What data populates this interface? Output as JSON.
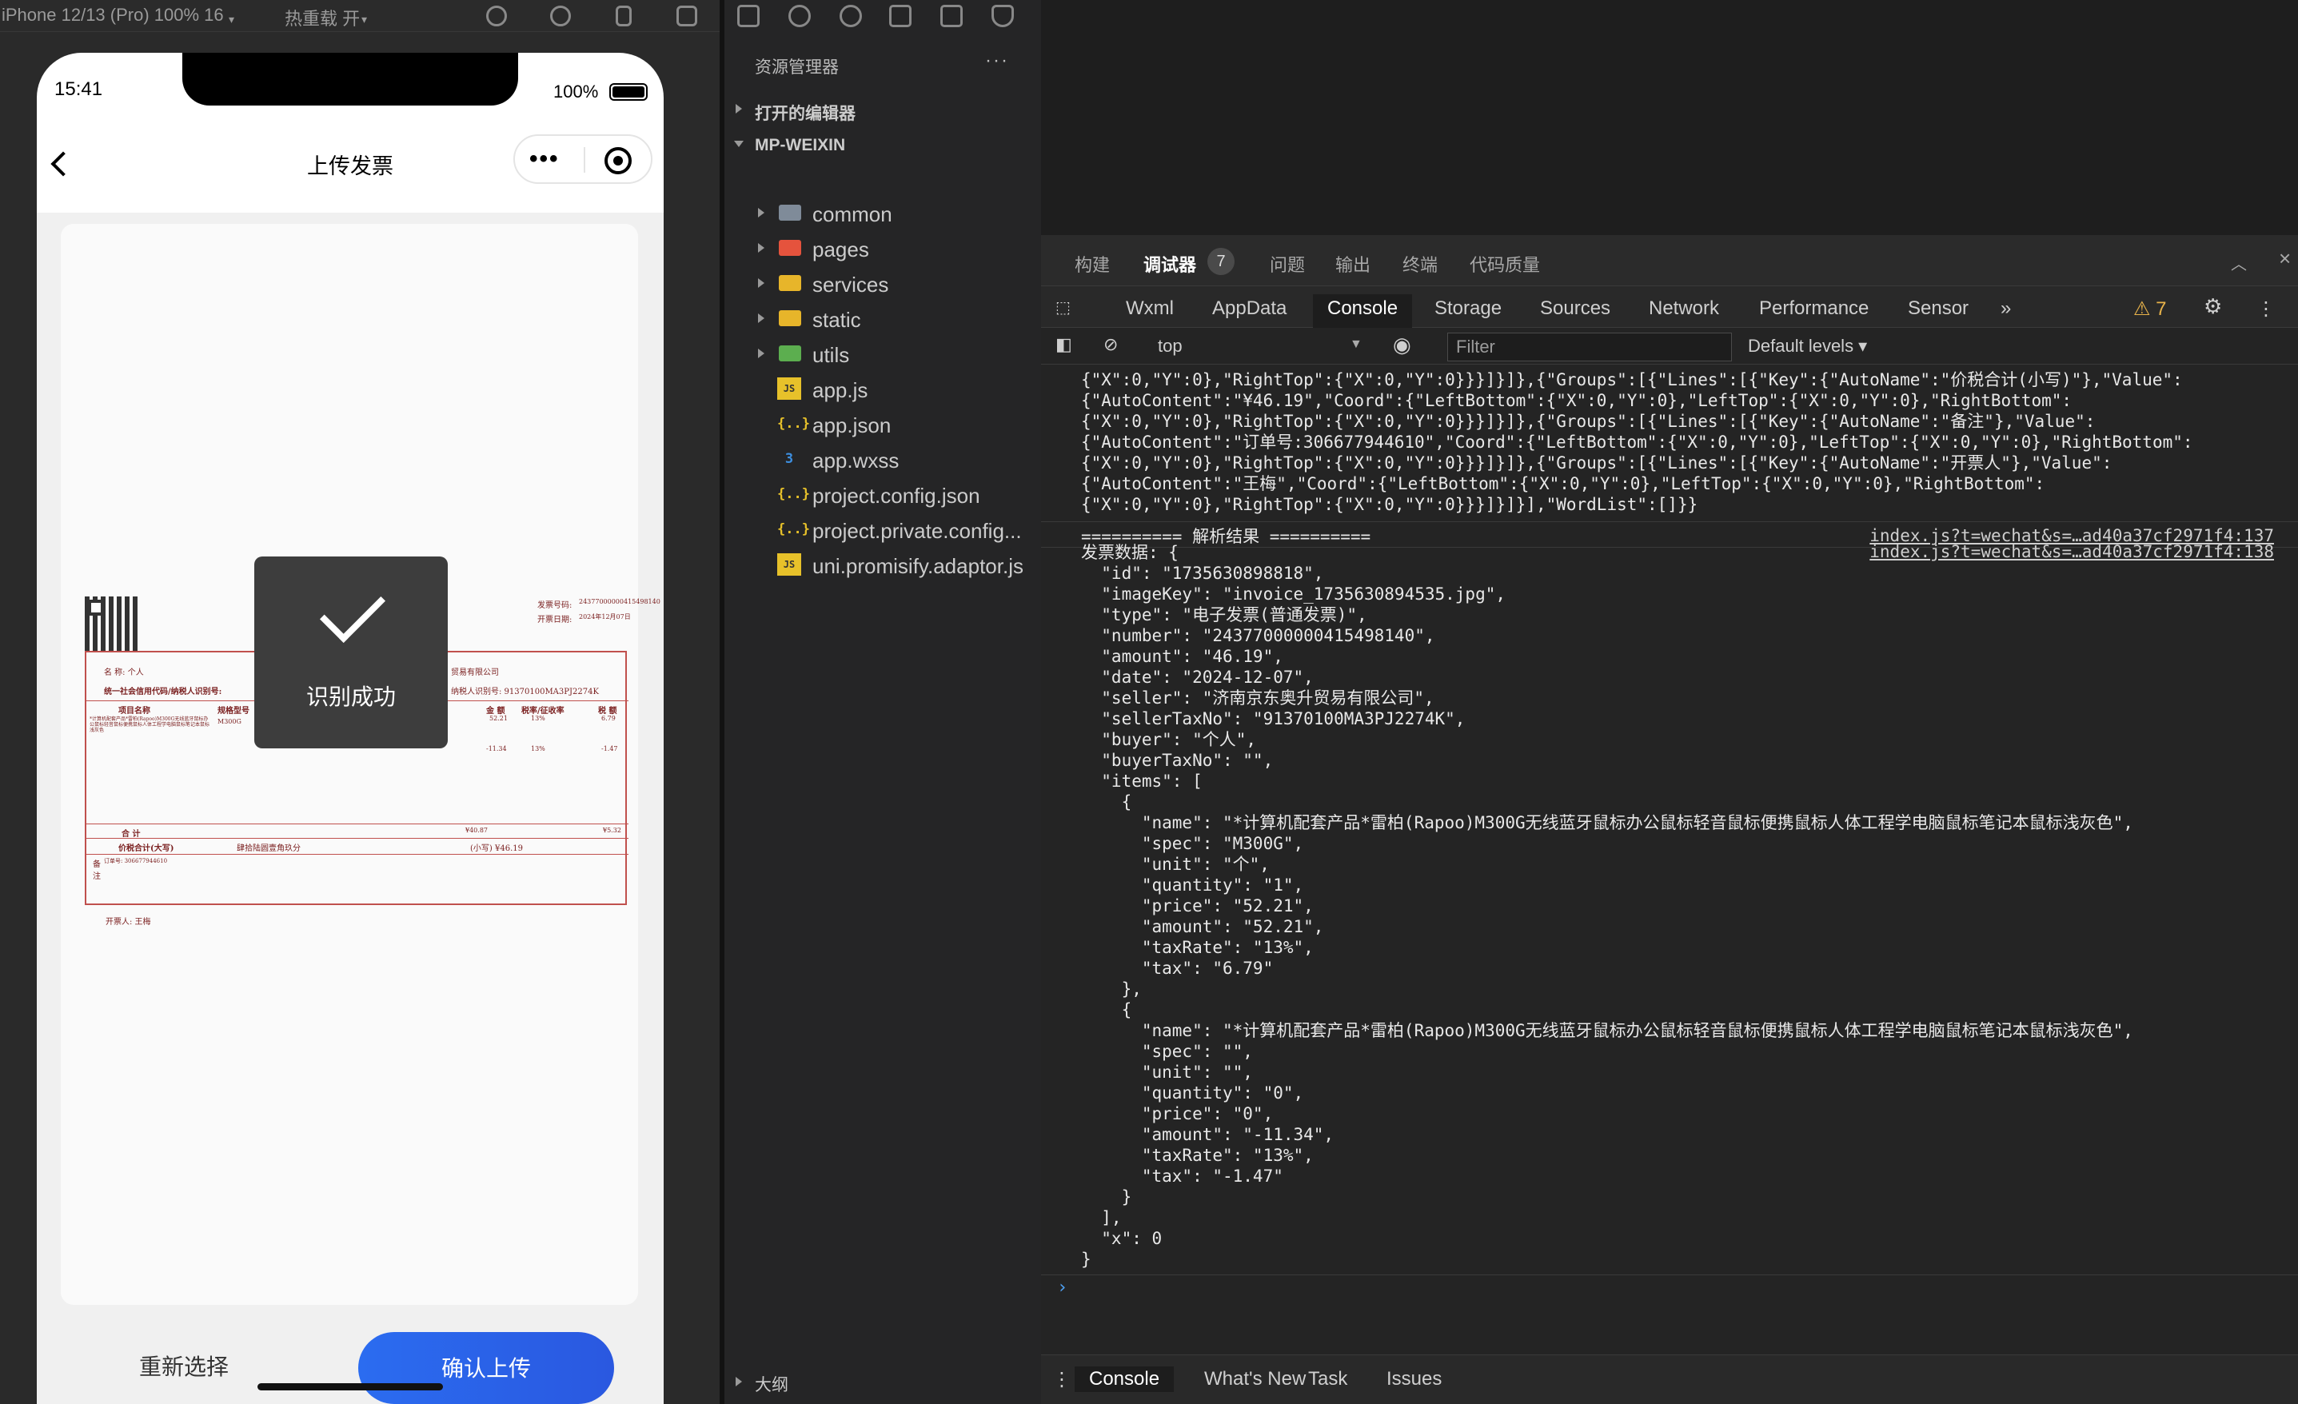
{
  "simulator": {
    "device_label": "iPhone 12/13 (Pro) 100% 16",
    "hot_reload_label": "热重载 开",
    "status_time": "15:41",
    "battery": "100%",
    "nav_title": "上传发票",
    "toast_text": "识别成功",
    "reselect_label": "重新选择",
    "confirm_label": "确认上传",
    "invoice": {
      "invoice_no_label": "发票号码:",
      "invoice_no": "24377000000415498140",
      "date_label": "开票日期:",
      "date": "2024年12月07日",
      "buyer_name": "名 称: 个人",
      "buyer_tax_label": "统一社会信用代码/纳税人识别号:",
      "seller_name": "贸易有限公司",
      "seller_tax": "纳税人识别号: 91370100MA3PJ2274K",
      "col_item": "项目名称",
      "col_spec": "规格型号",
      "col_amount": "金 额",
      "col_rate": "税率/征收率",
      "col_tax": "税 额",
      "row1_name": "*计算机配套产品*雷柏(Rapoo)M300G无线蓝牙鼠标办公鼠标轻音鼠标便携鼠标人体工程学电脑鼠标笔记本鼠标浅灰色",
      "row1_spec": "M300G",
      "row1_amount": "52.21",
      "row1_rate": "13%",
      "row1_tax": "6.79",
      "row2_amount": "-11.34",
      "row2_rate": "13%",
      "row2_tax": "-1.47",
      "total_label": "合 计",
      "total_amount": "¥40.87",
      "total_tax": "¥5.32",
      "grand_label": "价税合计(大写)",
      "grand_upper": "肆拾陆圆壹角玖分",
      "grand_lower": "(小写) ¥46.19",
      "remark_label": "备 注",
      "remark": "订单号: 306677944610",
      "drawer": "开票人: 王梅"
    }
  },
  "explorer": {
    "title": "资源管理器",
    "more": "···",
    "open_editors": "打开的编辑器",
    "project": "MP-WEIXIN",
    "folders": [
      {
        "name": "common",
        "color": "#7f8b99"
      },
      {
        "name": "pages",
        "color": "#e5533d"
      },
      {
        "name": "services",
        "color": "#e7b52a"
      },
      {
        "name": "static",
        "color": "#e7b52a"
      },
      {
        "name": "utils",
        "color": "#5cae4f"
      }
    ],
    "files": [
      {
        "name": "app.js",
        "icon": "JS",
        "color": "#e7c12a"
      },
      {
        "name": "app.json",
        "icon": "{..}",
        "color": "#e7c12a"
      },
      {
        "name": "app.wxss",
        "icon": "3",
        "color": "#3d8fe0"
      },
      {
        "name": "project.config.json",
        "icon": "{..}",
        "color": "#e7c12a"
      },
      {
        "name": "project.private.config...",
        "icon": "{..}",
        "color": "#e7c12a"
      },
      {
        "name": "uni.promisify.adaptor.js",
        "icon": "JS",
        "color": "#e7c12a"
      }
    ],
    "outline": "大纲"
  },
  "devtools": {
    "top_tabs": [
      "构建",
      "调试器",
      "问题",
      "输出",
      "终端",
      "代码质量"
    ],
    "debugger_badge": "7",
    "panel_tabs": [
      "Wxml",
      "AppData",
      "Console",
      "Storage",
      "Sources",
      "Network",
      "Performance",
      "Sensor"
    ],
    "more_tabs": "»",
    "warnings": "⚠ 7",
    "context": "top",
    "filter_placeholder": "Filter",
    "levels": "Default levels ▾",
    "prev_log": [
      "{\"X\":0,\"Y\":0},\"RightTop\":{\"X\":0,\"Y\":0}}}]}]},{\"Groups\":[{\"Lines\":[{\"Key\":{\"AutoName\":\"价税合计(小写)\"},\"Value\":",
      "{\"AutoContent\":\"¥46.19\",\"Coord\":{\"LeftBottom\":{\"X\":0,\"Y\":0},\"LeftTop\":{\"X\":0,\"Y\":0},\"RightBottom\":",
      "{\"X\":0,\"Y\":0},\"RightTop\":{\"X\":0,\"Y\":0}}}]}]},{\"Groups\":[{\"Lines\":[{\"Key\":{\"AutoName\":\"备注\"},\"Value\":",
      "{\"AutoContent\":\"订单号:306677944610\",\"Coord\":{\"LeftBottom\":{\"X\":0,\"Y\":0},\"LeftTop\":{\"X\":0,\"Y\":0},\"RightBottom\":",
      "{\"X\":0,\"Y\":0},\"RightTop\":{\"X\":0,\"Y\":0}}}]}]},{\"Groups\":[{\"Lines\":[{\"Key\":{\"AutoName\":\"开票人\"},\"Value\":",
      "{\"AutoContent\":\"王梅\",\"Coord\":{\"LeftBottom\":{\"X\":0,\"Y\":0},\"LeftTop\":{\"X\":0,\"Y\":0},\"RightBottom\":",
      "{\"X\":0,\"Y\":0},\"RightTop\":{\"X\":0,\"Y\":0}}}]}]}],\"WordList\":[]}}"
    ],
    "log_result_header": "========== 解析结果 ==========",
    "log_result_src": "index.js?t=wechat&s=…ad40a37cf2971f4:137",
    "log_data_src": "index.js?t=wechat&s=…ad40a37cf2971f4:138",
    "log_data": [
      "发票数据: {",
      "  \"id\": \"1735630898818\",",
      "  \"imageKey\": \"invoice_1735630894535.jpg\",",
      "  \"type\": \"电子发票(普通发票)\",",
      "  \"number\": \"24377000000415498140\",",
      "  \"amount\": \"46.19\",",
      "  \"date\": \"2024-12-07\",",
      "  \"seller\": \"济南京东奥升贸易有限公司\",",
      "  \"sellerTaxNo\": \"91370100MA3PJ2274K\",",
      "  \"buyer\": \"个人\",",
      "  \"buyerTaxNo\": \"\",",
      "  \"items\": [",
      "    {",
      "      \"name\": \"*计算机配套产品*雷柏(Rapoo)M300G无线蓝牙鼠标办公鼠标轻音鼠标便携鼠标人体工程学电脑鼠标笔记本鼠标浅灰色\",",
      "      \"spec\": \"M300G\",",
      "      \"unit\": \"个\",",
      "      \"quantity\": \"1\",",
      "      \"price\": \"52.21\",",
      "      \"amount\": \"52.21\",",
      "      \"taxRate\": \"13%\",",
      "      \"tax\": \"6.79\"",
      "    },",
      "    {",
      "      \"name\": \"*计算机配套产品*雷柏(Rapoo)M300G无线蓝牙鼠标办公鼠标轻音鼠标便携鼠标人体工程学电脑鼠标笔记本鼠标浅灰色\",",
      "      \"spec\": \"\",",
      "      \"unit\": \"\",",
      "      \"quantity\": \"0\",",
      "      \"price\": \"0\",",
      "      \"amount\": \"-11.34\",",
      "      \"taxRate\": \"13%\",",
      "      \"tax\": \"-1.47\"",
      "    }",
      "  ],",
      "  \"x\": 0",
      "}"
    ],
    "prompt": "›",
    "bottom_tabs": [
      "Console",
      "What's New",
      "Task",
      "Issues"
    ]
  }
}
